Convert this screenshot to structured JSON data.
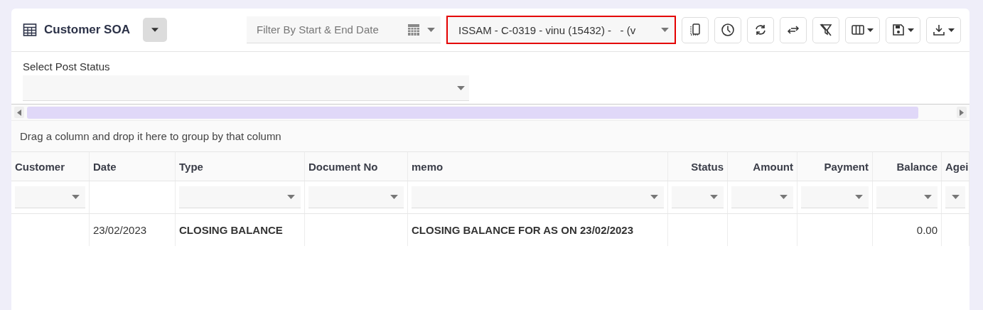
{
  "header": {
    "title": "Customer SOA",
    "date_filter": {
      "placeholder": "Filter By Start & End Date"
    },
    "customer_select": {
      "value": "ISSAM - C-0319 - vinu (15432) -   - (v",
      "highlighted": true
    },
    "tools": [
      {
        "kind": "mobile"
      },
      {
        "kind": "clock"
      },
      {
        "kind": "refresh"
      },
      {
        "kind": "swap"
      },
      {
        "kind": "filter-clear"
      },
      {
        "kind": "columns",
        "menu": true
      },
      {
        "kind": "save",
        "menu": true
      },
      {
        "kind": "download",
        "menu": true
      }
    ]
  },
  "post_status": {
    "label": "Select Post Status"
  },
  "group_panel": {
    "text": "Drag a column and drop it here to group by that column"
  },
  "table": {
    "columns": [
      {
        "label": "Customer",
        "kind": "text",
        "filter": true
      },
      {
        "label": "Date",
        "kind": "text",
        "filter": false
      },
      {
        "label": "Type",
        "kind": "text",
        "filter": true
      },
      {
        "label": "Document No",
        "kind": "text",
        "filter": true
      },
      {
        "label": "memo",
        "kind": "text",
        "filter": true
      },
      {
        "label": "Status",
        "kind": "number",
        "filter": true
      },
      {
        "label": "Amount",
        "kind": "number",
        "filter": true
      },
      {
        "label": "Payment",
        "kind": "number",
        "filter": true
      },
      {
        "label": "Balance",
        "kind": "number",
        "filter": true
      },
      {
        "label": "Agei",
        "kind": "text",
        "filter": true
      }
    ],
    "rows": [
      {
        "cells": [
          {},
          {
            "text": "23/02/2023",
            "bold": false
          },
          {
            "text": "CLOSING BALANCE",
            "bold": true
          },
          {},
          {
            "text": "CLOSING BALANCE FOR AS ON 23/02/2023",
            "bold": true
          },
          {},
          {},
          {},
          {
            "text": "0.00",
            "bold": false
          },
          {}
        ]
      }
    ]
  }
}
